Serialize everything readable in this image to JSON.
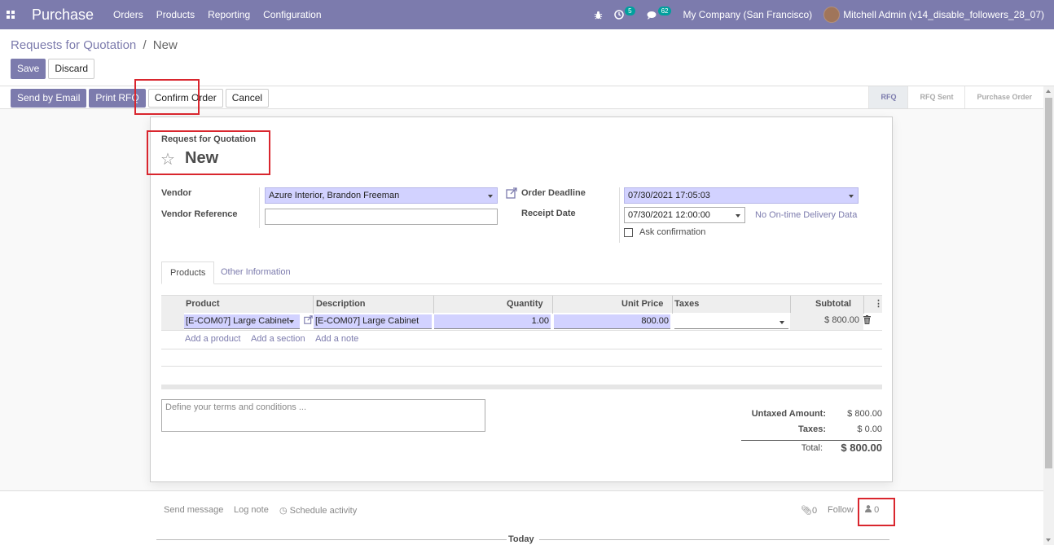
{
  "navbar": {
    "app_name": "Purchase",
    "menu": [
      "Orders",
      "Products",
      "Reporting",
      "Configuration"
    ],
    "activity_count": "5",
    "message_count": "62",
    "company": "My Company (San Francisco)",
    "user": "Mitchell Admin (v14_disable_followers_28_07)"
  },
  "breadcrumb": {
    "parent": "Requests for Quotation",
    "separator": "/",
    "current": "New"
  },
  "control_buttons": {
    "save": "Save",
    "discard": "Discard"
  },
  "header_buttons": {
    "send_email": "Send by Email",
    "print_rfq": "Print RFQ",
    "confirm_order": "Confirm Order",
    "cancel": "Cancel"
  },
  "stages": [
    "RFQ",
    "RFQ Sent",
    "Purchase Order"
  ],
  "active_stage": "RFQ",
  "form": {
    "doc_label": "Request for Quotation",
    "doc_name": "New",
    "vendor_label": "Vendor",
    "vendor_value": "Azure Interior, Brandon Freeman",
    "vendor_ref_label": "Vendor Reference",
    "vendor_ref_value": "",
    "order_deadline_label": "Order Deadline",
    "order_deadline_value": "07/30/2021 17:05:03",
    "receipt_date_label": "Receipt Date",
    "receipt_date_value": "07/30/2021 12:00:00",
    "delivery_data_link": "No On-time Delivery Data",
    "ask_confirmation_label": "Ask confirmation",
    "ask_confirmation_checked": false
  },
  "tabs": [
    "Products",
    "Other Information"
  ],
  "table": {
    "columns": [
      "Product",
      "Description",
      "Quantity",
      "Unit Price",
      "Taxes",
      "Subtotal"
    ],
    "rows": [
      {
        "product": "[E-COM07] Large Cabinet",
        "description": "[E-COM07] Large Cabinet",
        "quantity": "1.00",
        "unit_price": "800.00",
        "taxes": "",
        "subtotal": "$ 800.00"
      }
    ],
    "add_links": [
      "Add a product",
      "Add a section",
      "Add a note"
    ]
  },
  "notes_placeholder": "Define your terms and conditions ...",
  "totals": {
    "untaxed_label": "Untaxed Amount:",
    "untaxed_value": "$ 800.00",
    "taxes_label": "Taxes:",
    "taxes_value": "$ 0.00",
    "total_label": "Total:",
    "total_value": "$ 800.00"
  },
  "chatter": {
    "send_message": "Send message",
    "log_note": "Log note",
    "schedule_activity": "Schedule activity",
    "attachments_count": "0",
    "follow": "Follow",
    "followers_count": "0",
    "today": "Today"
  },
  "colors": {
    "brand": "#7c7bad",
    "required_field": "#d2d2ff",
    "highlight": "#d9262e"
  }
}
